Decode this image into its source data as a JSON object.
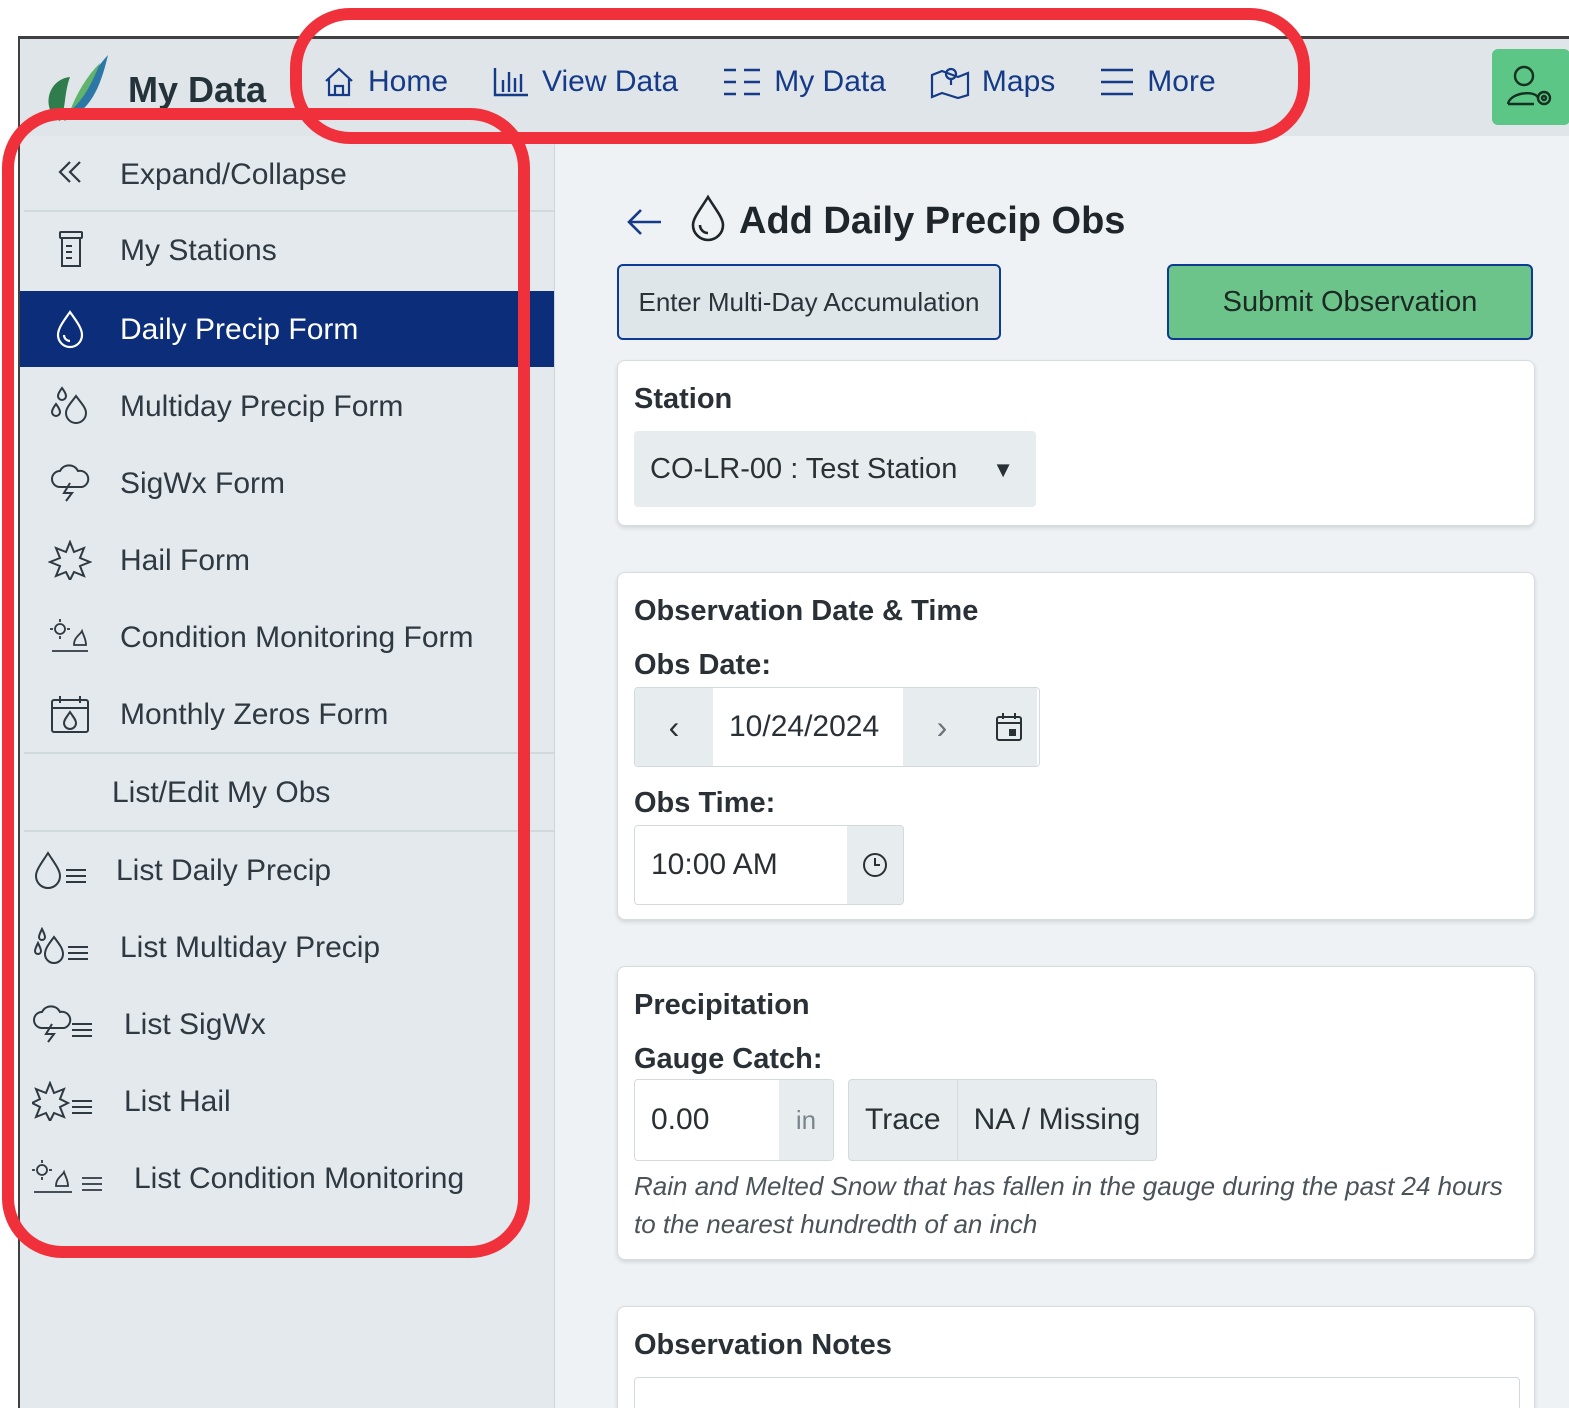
{
  "app": {
    "title": "My Data"
  },
  "nav": {
    "home": "Home",
    "view_data": "View Data",
    "my_data": "My Data",
    "maps": "Maps",
    "more": "More"
  },
  "sidebar": {
    "items": [
      {
        "label": "Expand/Collapse",
        "icon": "double-chevron-left-icon"
      },
      {
        "label": "My Stations",
        "icon": "rain-gauge-icon"
      },
      {
        "label": "Daily Precip Form",
        "icon": "droplet-icon",
        "active": true
      },
      {
        "label": "Multiday Precip Form",
        "icon": "multi-droplet-icon"
      },
      {
        "label": "SigWx Form",
        "icon": "storm-cloud-icon"
      },
      {
        "label": "Hail Form",
        "icon": "hail-burst-icon"
      },
      {
        "label": "Condition Monitoring Form",
        "icon": "condition-icon"
      },
      {
        "label": "Monthly Zeros Form",
        "icon": "calendar-droplet-icon"
      },
      {
        "label": "List/Edit My Obs"
      },
      {
        "label": "List Daily Precip",
        "icon": "droplet-list-icon"
      },
      {
        "label": "List Multiday Precip",
        "icon": "multi-droplet-list-icon"
      },
      {
        "label": "List SigWx",
        "icon": "storm-list-icon"
      },
      {
        "label": "List Hail",
        "icon": "hail-list-icon"
      },
      {
        "label": "List Condition Monitoring",
        "icon": "condition-list-icon"
      }
    ]
  },
  "main": {
    "title": "Add Daily Precip Obs",
    "multi_day_button": "Enter Multi-Day Accumulation",
    "submit_button": "Submit Observation",
    "station": {
      "title": "Station",
      "selected": "CO-LR-00 : Test Station"
    },
    "obs_datetime": {
      "title": "Observation Date & Time",
      "date_label": "Obs Date:",
      "date_value": "10/24/2024",
      "time_label": "Obs Time:",
      "time_value": "10:00 AM"
    },
    "precip": {
      "title": "Precipitation",
      "gauge_label": "Gauge Catch:",
      "gauge_value": "0.00",
      "unit": "in",
      "trace": "Trace",
      "missing": "NA / Missing",
      "help": "Rain and Melted Snow that has fallen in the gauge during the past 24 hours to the nearest hundredth of an inch"
    },
    "notes": {
      "title": "Observation Notes"
    }
  },
  "colors": {
    "accent_nav": "#153a87",
    "active_sidebar": "#0c2d79",
    "submit_green": "#6cc48b",
    "highlight_red": "#f0303a"
  }
}
